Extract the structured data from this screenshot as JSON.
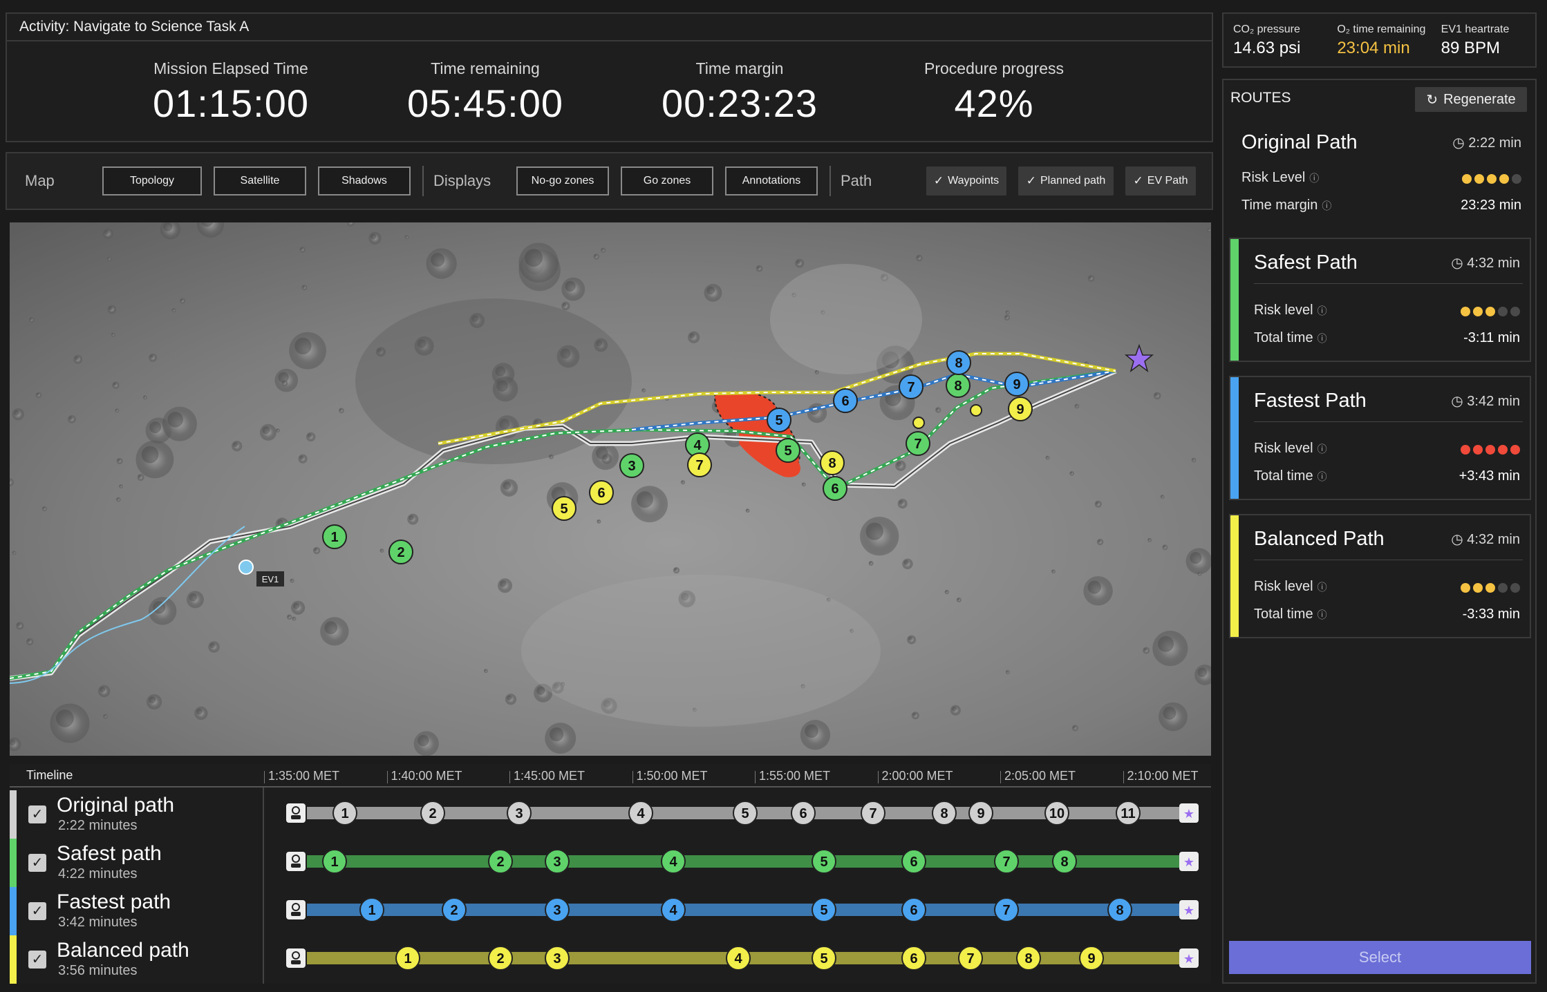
{
  "activity": {
    "title": "Activity: Navigate to Science Task A"
  },
  "stats": [
    {
      "label": "Mission Elapsed Time",
      "value": "01:15:00"
    },
    {
      "label": "Time remaining",
      "value": "05:45:00"
    },
    {
      "label": "Time margin",
      "value": "00:23:23"
    },
    {
      "label": "Procedure progress",
      "value": "42%"
    }
  ],
  "toolbar": {
    "map_label": "Map",
    "map_buttons": [
      "Topology",
      "Satellite",
      "Shadows"
    ],
    "displays_label": "Displays",
    "display_buttons": [
      "No-go zones",
      "Go zones",
      "Annotations"
    ],
    "path_label": "Path",
    "path_checks": [
      "Waypoints",
      "Planned path",
      "EV Path"
    ]
  },
  "map": {
    "ev_label": "EV1"
  },
  "timeline": {
    "title": "Timeline",
    "ticks": [
      "1:35:00 MET",
      "1:40:00 MET",
      "1:45:00 MET",
      "1:50:00 MET",
      "1:55:00 MET",
      "2:00:00 MET",
      "2:05:00 MET",
      "2:10:00 MET"
    ],
    "rows": [
      {
        "name": "Original path",
        "duration": "2:22 minutes",
        "color": "#d0d0d0",
        "bar": "#9a9a9a",
        "stops": [
          "1",
          "2",
          "3",
          "4",
          "5",
          "6",
          "7",
          "8",
          "9",
          "10",
          "11"
        ]
      },
      {
        "name": "Safest path",
        "duration": "4:22 minutes",
        "color": "#5fd36a",
        "bar": "#3f8f47",
        "stops": [
          "1",
          "2",
          "3",
          "4",
          "5",
          "6",
          "7",
          "8"
        ]
      },
      {
        "name": "Fastest path",
        "duration": "3:42 minutes",
        "color": "#4aa3f0",
        "bar": "#3b77b0",
        "stops": [
          "1",
          "2",
          "3",
          "4",
          "5",
          "6",
          "7",
          "8"
        ]
      },
      {
        "name": "Balanced path",
        "duration": "3:56 minutes",
        "color": "#f2ee4a",
        "bar": "#9c9a3a",
        "stops": [
          "1",
          "2",
          "3",
          "4",
          "5",
          "6",
          "7",
          "8",
          "9"
        ]
      }
    ]
  },
  "vitals": [
    {
      "label": "CO₂ pressure",
      "value": "14.63 psi",
      "color": "#ffffff"
    },
    {
      "label": "O₂ time remaining",
      "value": "23:04 min",
      "color": "#f5c242"
    },
    {
      "label": "EV1 heartrate",
      "value": "89 BPM",
      "color": "#ffffff"
    }
  ],
  "routes": {
    "title": "ROUTES",
    "regenerate": "Regenerate",
    "select": "Select",
    "cards": [
      {
        "name": "Original Path",
        "time": "2:22 min",
        "risk_label": "Risk Level",
        "risk": 4,
        "risk_color": "#f5c242",
        "metric_label": "Time margin",
        "metric_value": "23:23 min",
        "bar": ""
      },
      {
        "name": "Safest Path",
        "time": "4:32 min",
        "risk_label": "Risk level",
        "risk": 3,
        "risk_color": "#f5c242",
        "metric_label": "Total time",
        "metric_value": "-3:11 min",
        "bar": "#5fd36a"
      },
      {
        "name": "Fastest Path",
        "time": "3:42 min",
        "risk_label": "Risk level",
        "risk": 5,
        "risk_color": "#f04a3a",
        "metric_label": "Total time",
        "metric_value": "+3:43 min",
        "bar": "#4aa3f0"
      },
      {
        "name": "Balanced Path",
        "time": "4:32 min",
        "risk_label": "Risk level",
        "risk": 3,
        "risk_color": "#f5c242",
        "metric_label": "Total time",
        "metric_value": "-3:33 min",
        "bar": "#f2ee4a"
      }
    ]
  }
}
